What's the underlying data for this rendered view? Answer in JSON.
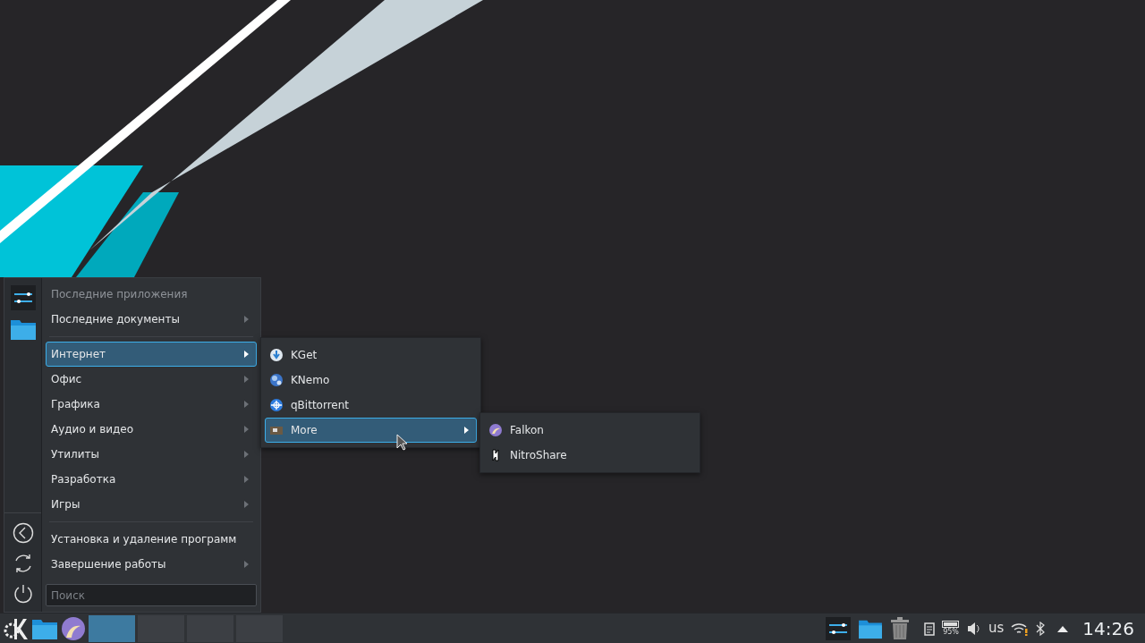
{
  "start_menu": {
    "items": [
      {
        "kind": "header",
        "label": "Последние приложения",
        "selected": false,
        "has_submenu": false
      },
      {
        "kind": "entry",
        "label": "Последние документы",
        "selected": false,
        "has_submenu": true
      },
      {
        "kind": "separator"
      },
      {
        "kind": "entry",
        "label": "Интернет",
        "selected": true,
        "has_submenu": true
      },
      {
        "kind": "entry",
        "label": "Офис",
        "selected": false,
        "has_submenu": true
      },
      {
        "kind": "entry",
        "label": "Графика",
        "selected": false,
        "has_submenu": true
      },
      {
        "kind": "entry",
        "label": "Аудио и видео",
        "selected": false,
        "has_submenu": true
      },
      {
        "kind": "entry",
        "label": "Утилиты",
        "selected": false,
        "has_submenu": true
      },
      {
        "kind": "entry",
        "label": "Разработка",
        "selected": false,
        "has_submenu": true
      },
      {
        "kind": "entry",
        "label": "Игры",
        "selected": false,
        "has_submenu": true
      },
      {
        "kind": "separator"
      },
      {
        "kind": "entry",
        "label": "Установка и удаление программ",
        "selected": false,
        "has_submenu": false
      },
      {
        "kind": "entry",
        "label": "Завершение работы",
        "selected": false,
        "has_submenu": true
      }
    ],
    "search": {
      "placeholder": "Поиск"
    }
  },
  "internet_submenu": {
    "items": [
      {
        "label": "KGet",
        "selected": false,
        "has_submenu": false
      },
      {
        "label": "KNemo",
        "selected": false,
        "has_submenu": false
      },
      {
        "label": "qBittorrent",
        "selected": false,
        "has_submenu": false
      },
      {
        "label": "More",
        "selected": true,
        "has_submenu": true
      }
    ]
  },
  "more_submenu": {
    "items": [
      {
        "label": "Falkon",
        "selected": false,
        "has_submenu": false
      },
      {
        "label": "NitroShare",
        "selected": false,
        "has_submenu": false
      }
    ]
  },
  "taskbar": {
    "desktops": [
      {
        "selected": true
      },
      {
        "selected": false
      },
      {
        "selected": false
      },
      {
        "selected": false
      }
    ],
    "tray": {
      "battery": "95%",
      "keyboard_layout": "us"
    },
    "clock": "14:26"
  }
}
